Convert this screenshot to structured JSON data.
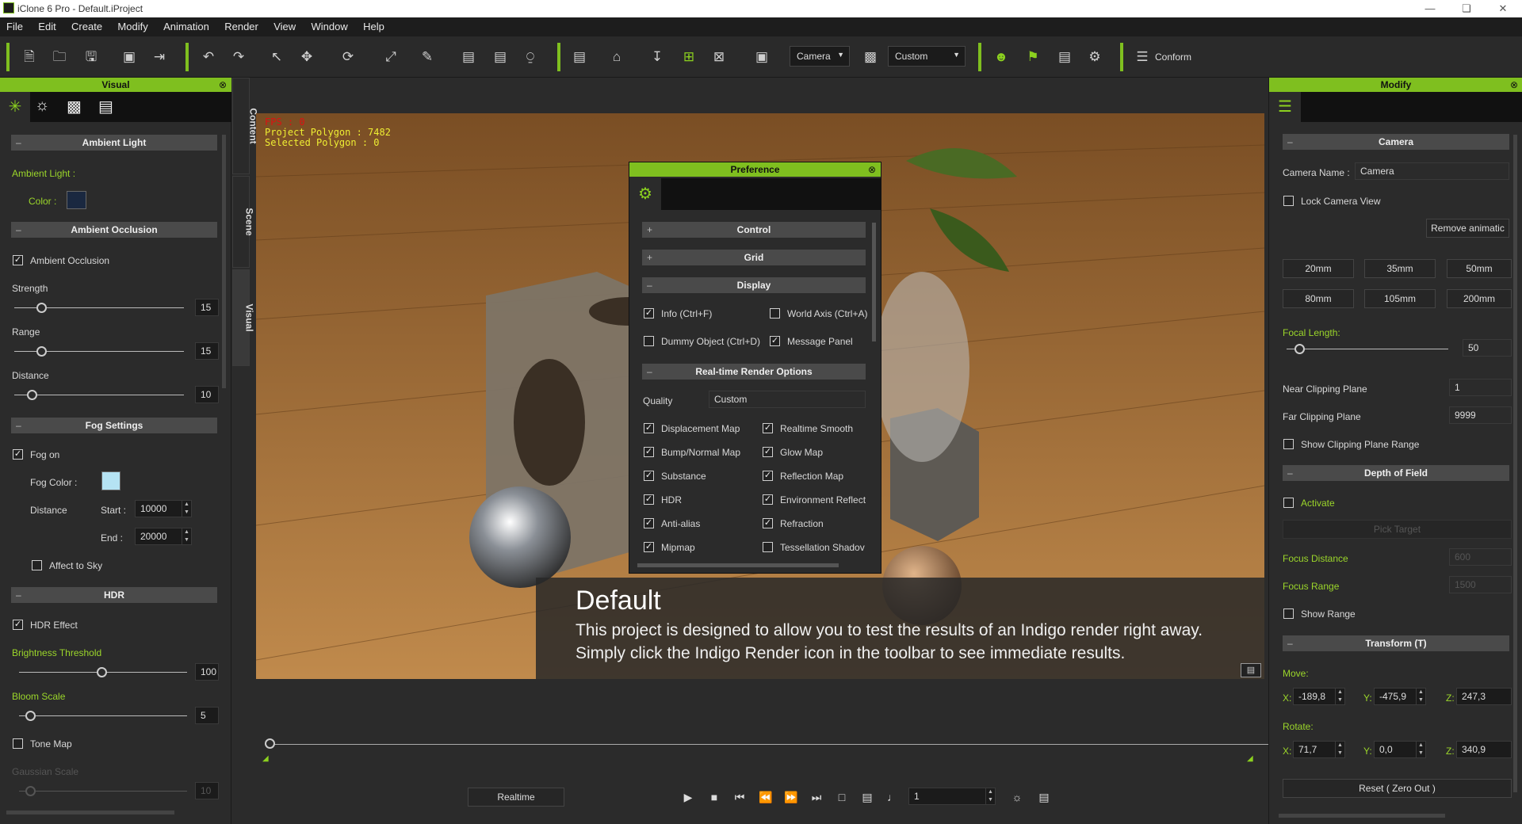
{
  "window": {
    "title": "iClone 6 Pro - Default.iProject"
  },
  "menu": [
    "File",
    "Edit",
    "Create",
    "Modify",
    "Animation",
    "Render",
    "View",
    "Window",
    "Help"
  ],
  "toolbar": {
    "camera_select": "Camera",
    "quality_select": "Custom",
    "conform_label": "Conform"
  },
  "visual_panel": {
    "title": "Visual",
    "ambient_light": {
      "section": "Ambient Light",
      "label": "Ambient Light :",
      "color_label": "Color :",
      "color": "#1a2840"
    },
    "ambient_occlusion": {
      "section": "Ambient Occlusion",
      "checkbox": "Ambient Occlusion",
      "strength_label": "Strength",
      "strength": "15",
      "range_label": "Range",
      "range": "15",
      "distance_label": "Distance",
      "distance": "10"
    },
    "fog": {
      "section": "Fog Settings",
      "fog_on": "Fog on",
      "fog_color_label": "Fog Color :",
      "fog_color": "#b5e3f3",
      "distance_label": "Distance",
      "start_label": "Start :",
      "start": "10000",
      "end_label": "End :",
      "end": "20000",
      "affect_sky": "Affect to Sky"
    },
    "hdr": {
      "section": "HDR",
      "hdr_effect": "HDR Effect",
      "brightness_label": "Brightness Threshold",
      "brightness": "100",
      "bloom_label": "Bloom Scale",
      "bloom": "5",
      "tone_map": "Tone Map",
      "gaussian_label": "Gaussian Scale",
      "gaussian": "10"
    }
  },
  "side_tabs": [
    "Content",
    "Scene",
    "Visual"
  ],
  "viewport": {
    "fps": "FPS : 0",
    "polygon": "Project Polygon : 7482",
    "selected": "Selected Polygon : 0",
    "caption_title": "Default",
    "caption_line1": "This project is designed to allow you to test the results of an Indigo render right away.",
    "caption_line2": "Simply click the Indigo Render icon in the toolbar to see immediate results."
  },
  "preference": {
    "title": "Preference",
    "control": "Control",
    "grid": "Grid",
    "display": "Display",
    "info": "Info (Ctrl+F)",
    "world_axis": "World Axis (Ctrl+A)",
    "dummy": "Dummy Object (Ctrl+D)",
    "message": "Message Panel",
    "realtime": "Real-time Render Options",
    "quality_label": "Quality",
    "quality": "Custom",
    "options": [
      [
        "Displacement Map",
        "Realtime Smooth"
      ],
      [
        "Bump/Normal Map",
        "Glow Map"
      ],
      [
        "Substance",
        "Reflection Map"
      ],
      [
        "HDR",
        "Environment Reflect"
      ],
      [
        "Anti-alias",
        "Refraction"
      ],
      [
        "Mipmap",
        "Tessellation Shadov"
      ]
    ]
  },
  "modify_panel": {
    "title": "Modify",
    "camera_section": "Camera",
    "camera_name_label": "Camera Name :",
    "camera_name": "Camera",
    "lock_view": "Lock Camera View",
    "remove_anim": "Remove  animatic",
    "lenses": [
      "20mm",
      "35mm",
      "50mm",
      "80mm",
      "105mm",
      "200mm"
    ],
    "focal_label": "Focal Length:",
    "focal": "50",
    "near_label": "Near Clipping Plane",
    "near": "1",
    "far_label": "Far Clipping Plane",
    "far": "9999",
    "show_clip": "Show Clipping Plane Range",
    "dof_section": "Depth of Field",
    "activate": "Activate",
    "pick_target": "Pick Target",
    "focus_distance_label": "Focus Distance",
    "focus_distance": "600",
    "focus_range_label": "Focus Range",
    "focus_range": "1500",
    "show_range": "Show Range",
    "transform_section": "Transform  (T)",
    "move_label": "Move:",
    "move": {
      "x": "-189,8",
      "y": "-475,9",
      "z": "247,3"
    },
    "rotate_label": "Rotate:",
    "rotate": {
      "x": "71,7",
      "y": "0,0",
      "z": "340,9"
    },
    "axis": {
      "x": "X:",
      "y": "Y:",
      "z": "Z:"
    },
    "reset": "Reset ( Zero Out )"
  },
  "playback": {
    "mode": "Realtime",
    "frame": "1"
  }
}
